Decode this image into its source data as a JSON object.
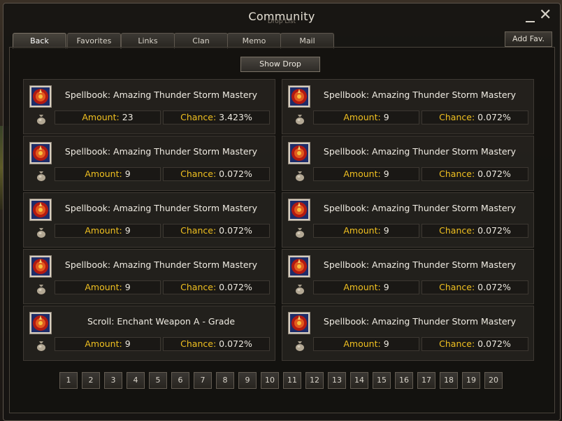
{
  "window": {
    "title": "Community",
    "subtitle": "Drop List"
  },
  "tabs": [
    {
      "label": "Back",
      "active": true
    },
    {
      "label": "Favorites"
    },
    {
      "label": "Links"
    },
    {
      "label": "Clan"
    },
    {
      "label": "Memo"
    },
    {
      "label": "Mail"
    }
  ],
  "add_fav_label": "Add Fav.",
  "show_drop_label": "Show Drop",
  "labels": {
    "amount": "Amount:",
    "chance": "Chance:"
  },
  "items": [
    {
      "name": "Spellbook: Amazing Thunder Storm Mastery",
      "amount": "23",
      "chance": "3.423%"
    },
    {
      "name": "Spellbook: Amazing Thunder Storm Mastery",
      "amount": "9",
      "chance": "0.072%"
    },
    {
      "name": "Spellbook: Amazing Thunder Storm Mastery",
      "amount": "9",
      "chance": "0.072%"
    },
    {
      "name": "Spellbook: Amazing Thunder Storm Mastery",
      "amount": "9",
      "chance": "0.072%"
    },
    {
      "name": "Spellbook: Amazing Thunder Storm Mastery",
      "amount": "9",
      "chance": "0.072%"
    },
    {
      "name": "Spellbook: Amazing Thunder Storm Mastery",
      "amount": "9",
      "chance": "0.072%"
    },
    {
      "name": "Spellbook: Amazing Thunder Storm Mastery",
      "amount": "9",
      "chance": "0.072%"
    },
    {
      "name": "Spellbook: Amazing Thunder Storm Mastery",
      "amount": "9",
      "chance": "0.072%"
    },
    {
      "name": "Scroll: Enchant Weapon A - Grade",
      "amount": "9",
      "chance": "0.072%"
    },
    {
      "name": "Spellbook: Amazing Thunder Storm Mastery",
      "amount": "9",
      "chance": "0.072%"
    }
  ],
  "pages": [
    "1",
    "2",
    "3",
    "4",
    "5",
    "6",
    "7",
    "8",
    "9",
    "10",
    "11",
    "12",
    "13",
    "14",
    "15",
    "16",
    "17",
    "18",
    "19",
    "20"
  ],
  "icons": {
    "item": "spellbook-icon",
    "bag": "money-bag-icon"
  },
  "colors": {
    "label": "#f0c020",
    "icon_red": "#b21a12"
  }
}
